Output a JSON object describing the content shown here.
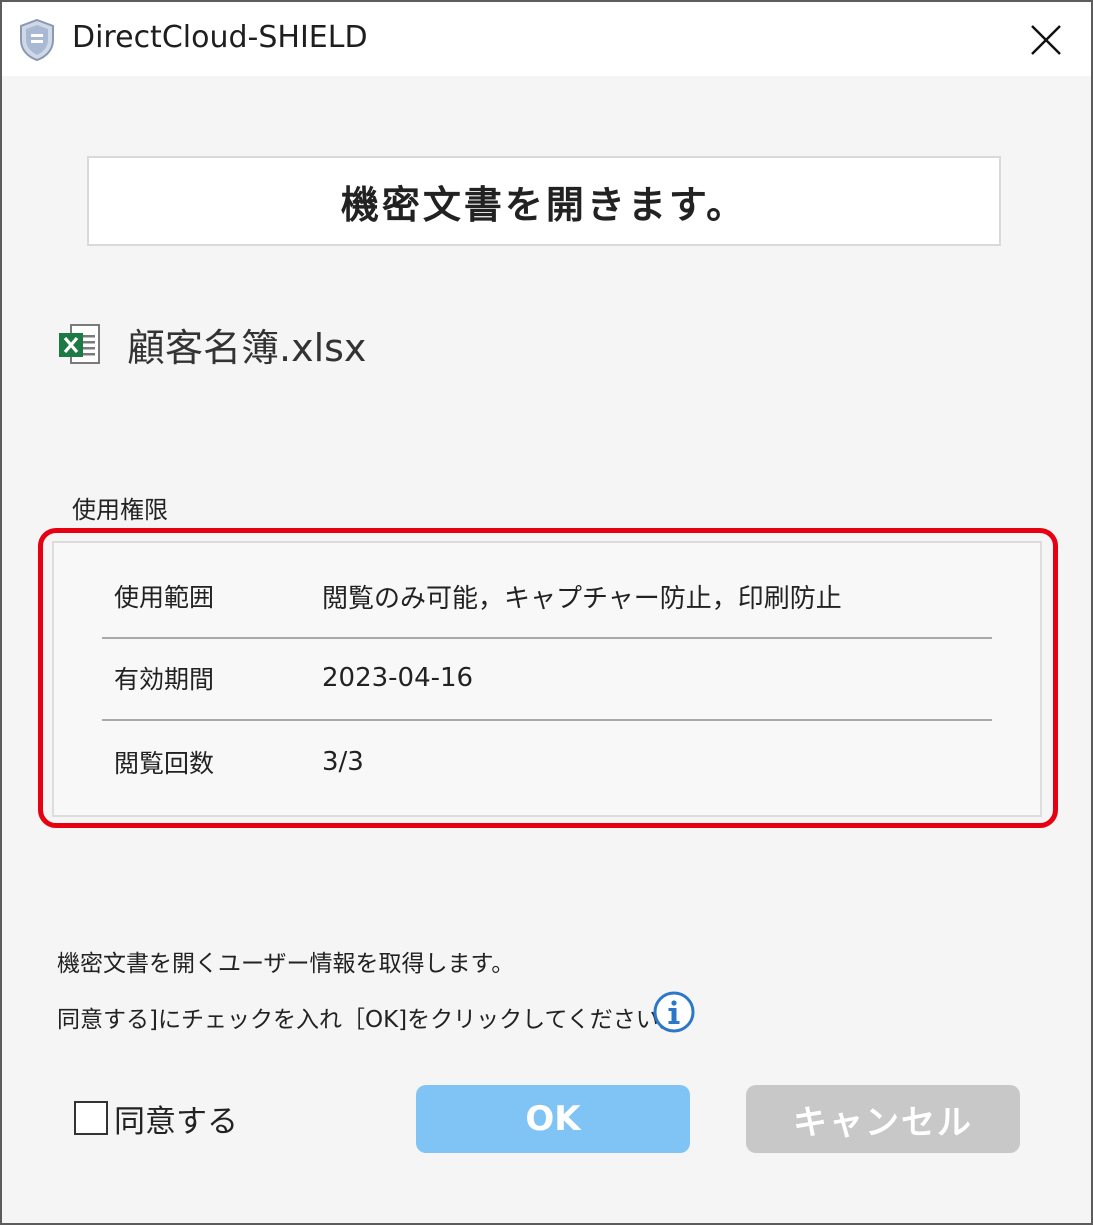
{
  "window": {
    "title": "DirectCloud-SHIELD"
  },
  "headline": "機密文書を開きます。",
  "file": {
    "name": "顧客名簿.xlsx",
    "icon": "excel-file-icon"
  },
  "permissions": {
    "title": "使用権限",
    "rows": [
      {
        "label": "使用範囲",
        "value": "閲覧のみ可能，キャプチャー防止，印刷防止"
      },
      {
        "label": "有効期間",
        "value": "2023-04-16"
      },
      {
        "label": "閲覧回数",
        "value": "3/3"
      }
    ]
  },
  "notice": {
    "line1": "機密文書を開くユーザー情報を取得します。",
    "line2": "同意する]にチェックを入れ［OK]をクリックしてください。"
  },
  "agree": {
    "label": "同意する",
    "checked": false
  },
  "buttons": {
    "ok": "OK",
    "cancel": "キャンセル"
  },
  "colors": {
    "highlight": "#e60012",
    "ok_button": "#7fc4f5",
    "cancel_button": "#c8c8c8",
    "excel_green": "#1d7a45",
    "info_blue": "#2b78c9"
  }
}
